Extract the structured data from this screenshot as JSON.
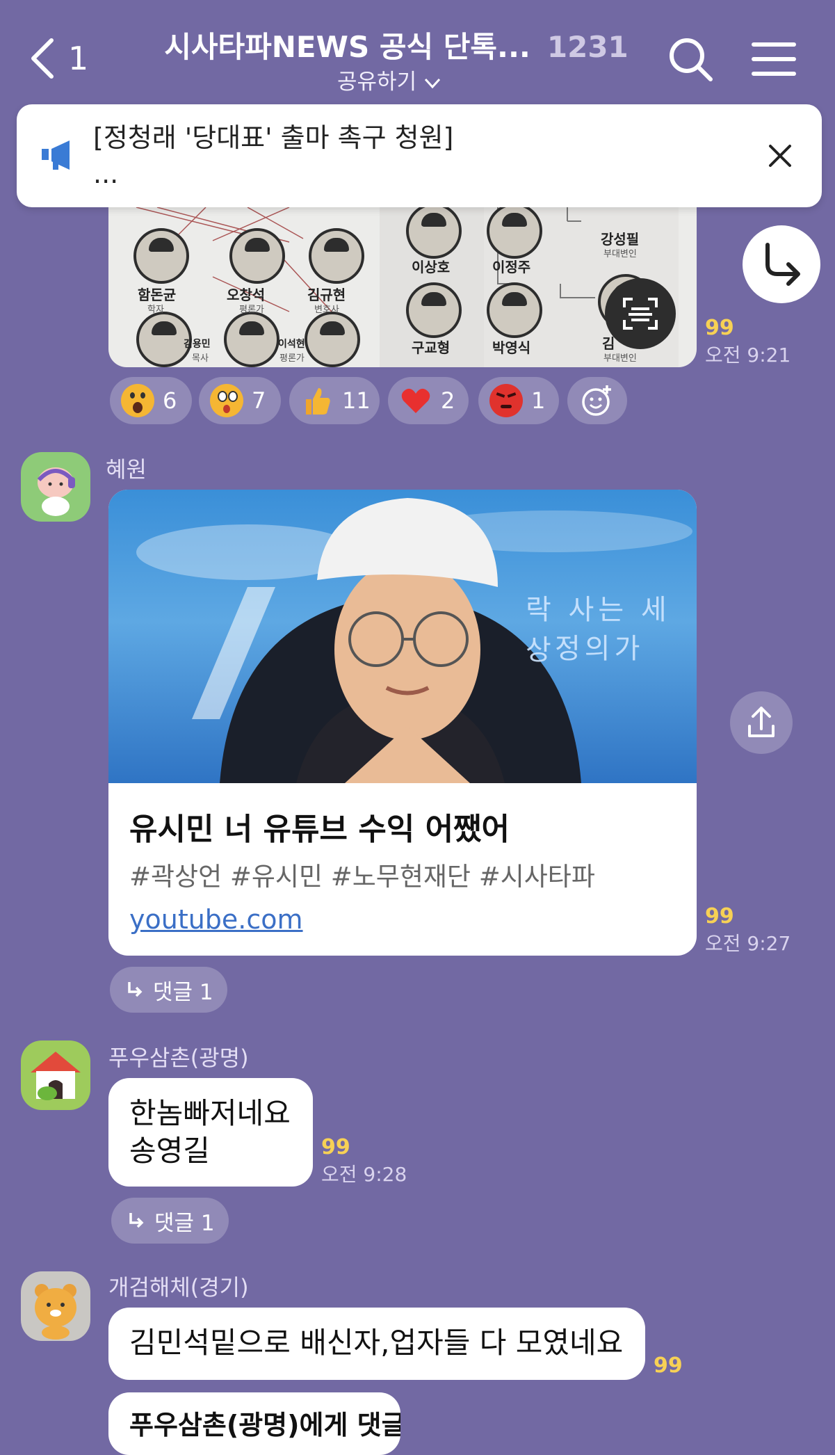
{
  "header": {
    "back_count": "1",
    "title": "시사타파NEWS 공식 단톡...",
    "member_count": "1231",
    "share_label": "공유하기"
  },
  "notice": {
    "text": "[정청래 '당대표' 출마 촉구 청원]",
    "more": "..."
  },
  "image_message": {
    "names": [
      "함돈균",
      "오창석",
      "김규현",
      "이상호",
      "이정주",
      "강성필",
      "김용민",
      "이석현",
      "구교형",
      "박영식",
      "김"
    ],
    "roles": [
      "학자",
      "평론가",
      "변호사",
      "부대변인",
      "목사",
      "평론가",
      "부대변인"
    ],
    "unread": "99",
    "time": "오전 9:21"
  },
  "reactions": [
    {
      "emoji": "surprised",
      "count": "6"
    },
    {
      "emoji": "wow",
      "count": "7"
    },
    {
      "emoji": "thumbs-up",
      "count": "11"
    },
    {
      "emoji": "heart",
      "count": "2"
    },
    {
      "emoji": "angry",
      "count": "1"
    }
  ],
  "messages": {
    "m1": {
      "sender": "혜원",
      "link_title": "유시민 너 유튜브 수익 어쨌어",
      "link_tags": "#곽상언 #유시민 #노무현재단 #시사타파",
      "link_url": "youtube.com",
      "thumb_text_1": "락 사는 세상",
      "thumb_text_2": "정의가",
      "unread": "99",
      "time": "오전 9:27",
      "reply_label": "댓글 1"
    },
    "m2": {
      "sender": "푸우삼촌(광명)",
      "line1": "한놈빠저네요",
      "line2": "송영길",
      "unread": "99",
      "time": "오전 9:28",
      "reply_label": "댓글 1"
    },
    "m3": {
      "sender": "개검해체(경기)",
      "text": "김민석밑으로 배신자,업자들 다 모였네요",
      "unread": "99",
      "next_partial": "푸우삼촌(광명)에게 댓글"
    }
  },
  "colors": {
    "background": "#7269a3",
    "unread": "#f7d155",
    "link": "#3b6fc6"
  }
}
